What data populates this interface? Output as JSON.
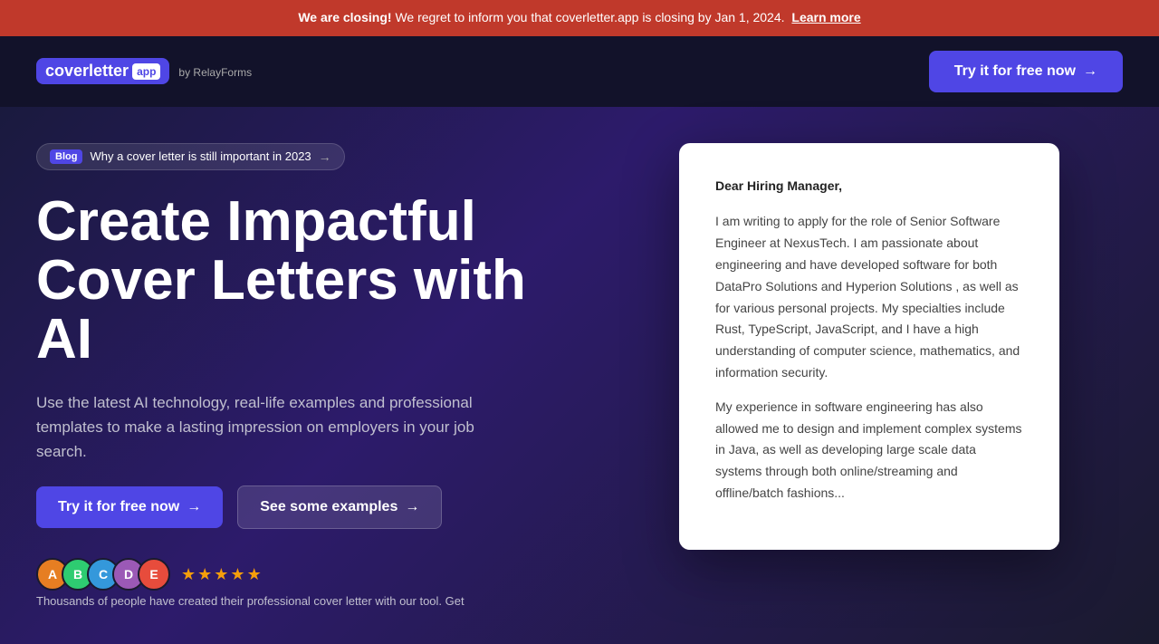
{
  "banner": {
    "text_bold": "We are closing!",
    "text": " We regret to inform you that coverletter.app is closing by Jan 1, 2024.",
    "link_text": "Learn more",
    "link_href": "#"
  },
  "navbar": {
    "logo_name": "coverletter",
    "logo_app": "app",
    "logo_by": "by RelayForms",
    "cta_label": "Try it for free now",
    "cta_arrow": "→"
  },
  "hero": {
    "blog_pill_label": "Blog",
    "blog_pill_text": "Why a cover letter is still important in 2023",
    "blog_pill_arrow": "→",
    "heading_line1": "Create Impactful",
    "heading_line2": "Cover Letters with AI",
    "description": "Use the latest AI technology, real-life examples and professional templates to make a lasting impression on employers in your job search.",
    "btn_primary_label": "Try it for free now",
    "btn_primary_arrow": "→",
    "btn_secondary_label": "See some examples",
    "btn_secondary_arrow": "→",
    "social_proof_text": "Thousands of people have created their professional cover letter with our tool. Get"
  },
  "avatars": [
    {
      "color": "#e67e22",
      "letter": "A"
    },
    {
      "color": "#2ecc71",
      "letter": "B"
    },
    {
      "color": "#3498db",
      "letter": "C"
    },
    {
      "color": "#9b59b6",
      "letter": "D"
    },
    {
      "color": "#e74c3c",
      "letter": "E"
    }
  ],
  "stars": [
    "★",
    "★",
    "★",
    "★",
    "★"
  ],
  "cover_letter": {
    "salutation": "Dear Hiring Manager,",
    "paragraph1": "I am writing to apply for the role of Senior Software Engineer at NexusTech. I am passionate about engineering and have developed software for both DataPro Solutions and Hyperion Solutions , as well as for various personal projects. My specialties include Rust, TypeScript,  JavaScript, and I have a high understanding of computer science, mathematics, and information security.",
    "paragraph2": "My experience in software engineering has also allowed me to design and implement complex systems in Java, as well as developing large scale data systems through both online/streaming and offline/batch fashions..."
  }
}
